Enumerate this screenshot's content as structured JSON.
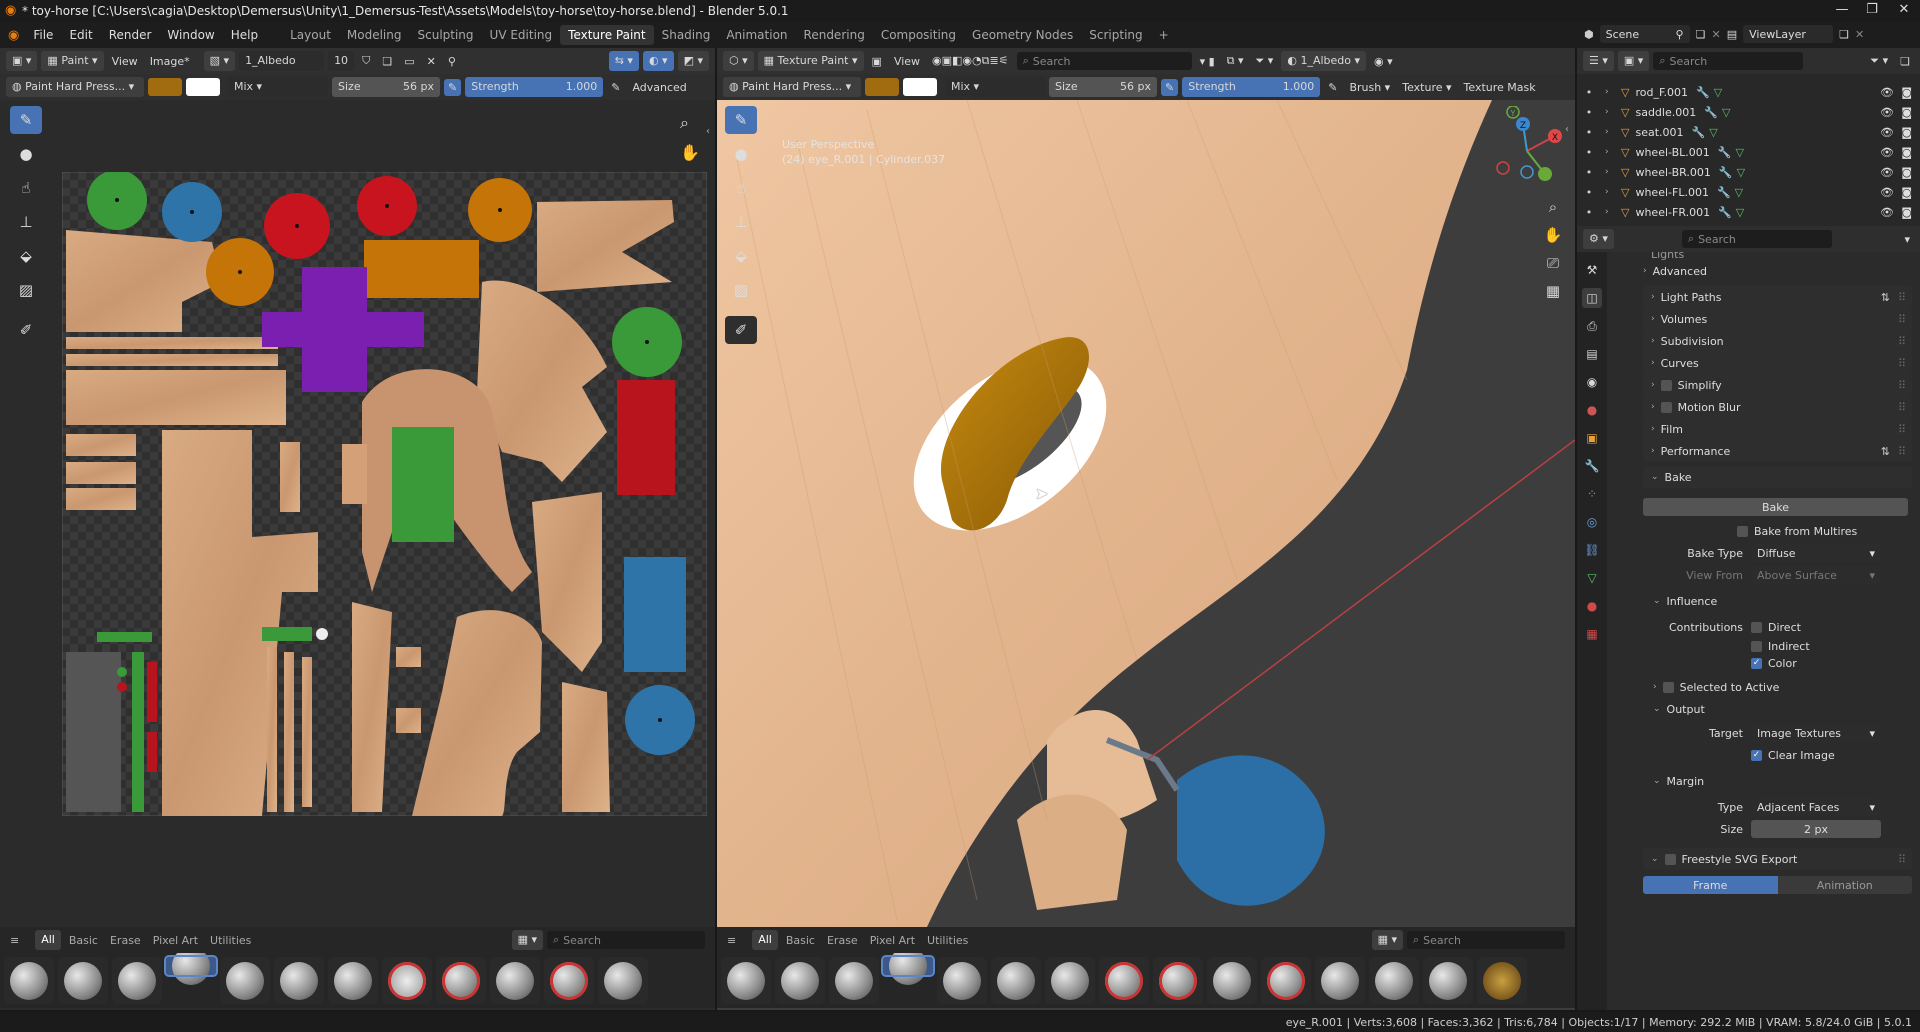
{
  "window": {
    "title": "* toy-horse [C:\\Users\\cagia\\Desktop\\Demersus\\Unity\\1_Demersus-Test\\Assets\\Models\\toy-horse\\toy-horse.blend] - Blender 5.0.1"
  },
  "menu": [
    "File",
    "Edit",
    "Render",
    "Window",
    "Help"
  ],
  "workspaces": [
    {
      "label": "Layout",
      "active": false
    },
    {
      "label": "Modeling",
      "active": false
    },
    {
      "label": "Sculpting",
      "active": false
    },
    {
      "label": "UV Editing",
      "active": false
    },
    {
      "label": "Texture Paint",
      "active": true
    },
    {
      "label": "Shading",
      "active": false
    },
    {
      "label": "Animation",
      "active": false
    },
    {
      "label": "Rendering",
      "active": false
    },
    {
      "label": "Compositing",
      "active": false
    },
    {
      "label": "Geometry Nodes",
      "active": false
    },
    {
      "label": "Scripting",
      "active": false
    }
  ],
  "add_workspace": "+",
  "scene": {
    "label": "Scene",
    "view_layer": "ViewLayer"
  },
  "image_editor": {
    "mode": "Paint",
    "view": "View",
    "image_menu": "Image*",
    "image_name": "1_Albedo",
    "users": "10",
    "brush_name": "Paint Hard Press...",
    "blend": "Mix",
    "size_label": "Size",
    "size_value": "56 px",
    "strength_label": "Strength",
    "strength_value": "1.000",
    "advanced": "Advanced",
    "color_primary": "#a16c10",
    "color_secondary": "#ffffff"
  },
  "viewport": {
    "mode": "Texture Paint",
    "view": "View",
    "search_placeholder": "Search",
    "image_name": "1_Albedo",
    "brush_name": "Paint Hard Press...",
    "blend": "Mix",
    "size_label": "Size",
    "size_value": "56 px",
    "strength_label": "Strength",
    "strength_value": "1.000",
    "brush_menu": "Brush",
    "texture_menu": "Texture",
    "texture_mask": "Texture Mask",
    "overlay_line1": "User Perspective",
    "overlay_line2": "(24) eye_R.001 | Cylinder.037",
    "gizmo": {
      "x": "X",
      "y": "Y",
      "z": "Z"
    }
  },
  "brush_tabs": [
    "All",
    "Basic",
    "Erase",
    "Pixel Art",
    "Utilities"
  ],
  "brush_search_placeholder": "Search",
  "outliner": {
    "search_placeholder": "Search",
    "items": [
      "rod_F.001",
      "saddle.001",
      "seat.001",
      "wheel-BL.001",
      "wheel-BR.001",
      "wheel-FL.001",
      "wheel-FR.001"
    ]
  },
  "properties": {
    "search_placeholder": "Search",
    "cut_off": "Lights",
    "advanced": "Advanced",
    "panels": [
      "Light Paths",
      "Volumes",
      "Subdivision",
      "Curves",
      "Simplify",
      "Motion Blur",
      "Film",
      "Performance"
    ],
    "bake": {
      "title": "Bake",
      "bake_button": "Bake",
      "bake_from_multires": "Bake from Multires",
      "bake_type_label": "Bake Type",
      "bake_type": "Diffuse",
      "view_from_label": "View From",
      "view_from": "Above Surface",
      "influence": "Influence",
      "contributions": "Contributions",
      "direct": "Direct",
      "indirect": "Indirect",
      "color": "Color",
      "selected_to_active": "Selected to Active",
      "output": "Output",
      "target_label": "Target",
      "target": "Image Textures",
      "clear_image": "Clear Image",
      "margin": "Margin",
      "type_label": "Type",
      "type": "Adjacent Faces",
      "size_label": "Size",
      "size": "2 px"
    },
    "freestyle": "Freestyle SVG Export",
    "frame": "Frame",
    "animation": "Animation"
  },
  "status": "eye_R.001 | Verts:3,608 | Faces:3,362 | Tris:6,784 | Objects:1/17 | Memory: 292.2 MiB | VRAM: 5.8/24.0 GiB | 5.0.1"
}
